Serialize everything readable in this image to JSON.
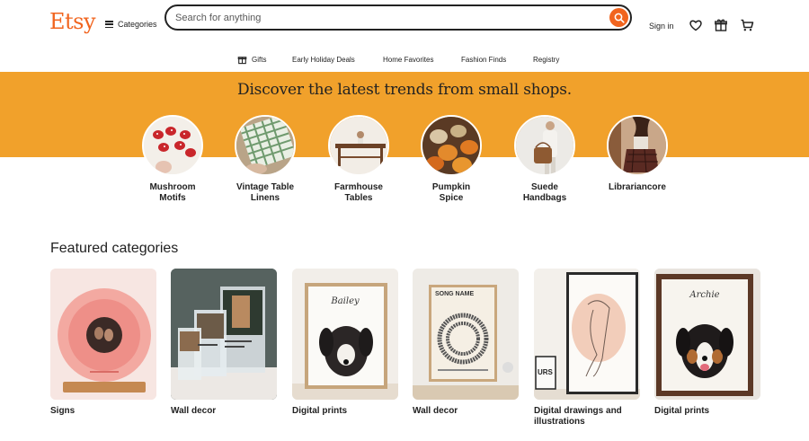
{
  "header": {
    "logo": "Etsy",
    "categories_label": "Categories",
    "search_placeholder": "Search for anything",
    "signin_label": "Sign in"
  },
  "nav": {
    "items": [
      {
        "label": "Gifts",
        "icon": "gift-icon"
      },
      {
        "label": "Early Holiday Deals"
      },
      {
        "label": "Home Favorites"
      },
      {
        "label": "Fashion Finds"
      },
      {
        "label": "Registry"
      }
    ]
  },
  "banner": {
    "title": "Discover the latest trends from small shops.",
    "color": "#f1a12b"
  },
  "trends": [
    {
      "line1": "Mushroom",
      "line2": "Motifs"
    },
    {
      "line1": "Vintage Table",
      "line2": "Linens"
    },
    {
      "line1": "Farmhouse",
      "line2": "Tables"
    },
    {
      "line1": "Pumpkin",
      "line2": "Spice"
    },
    {
      "line1": "Suede",
      "line2": "Handbags"
    },
    {
      "line1": "Librariancore",
      "line2": ""
    }
  ],
  "featured": {
    "title": "Featured categories",
    "cards": [
      {
        "line1": "Signs",
        "line2": ""
      },
      {
        "line1": "Wall decor",
        "line2": ""
      },
      {
        "line1": "Digital prints",
        "line2": ""
      },
      {
        "line1": "Wall decor",
        "line2": ""
      },
      {
        "line1": "Digital drawings and",
        "line2": "illustrations"
      },
      {
        "line1": "Digital prints",
        "line2": ""
      }
    ],
    "frame_texts": {
      "bailey": "Bailey",
      "song_name": "SONG NAME",
      "archie": "Archie",
      "urs": "URS"
    }
  },
  "colors": {
    "brand": "#f1641e",
    "banner": "#f1a12b",
    "text": "#222222"
  }
}
